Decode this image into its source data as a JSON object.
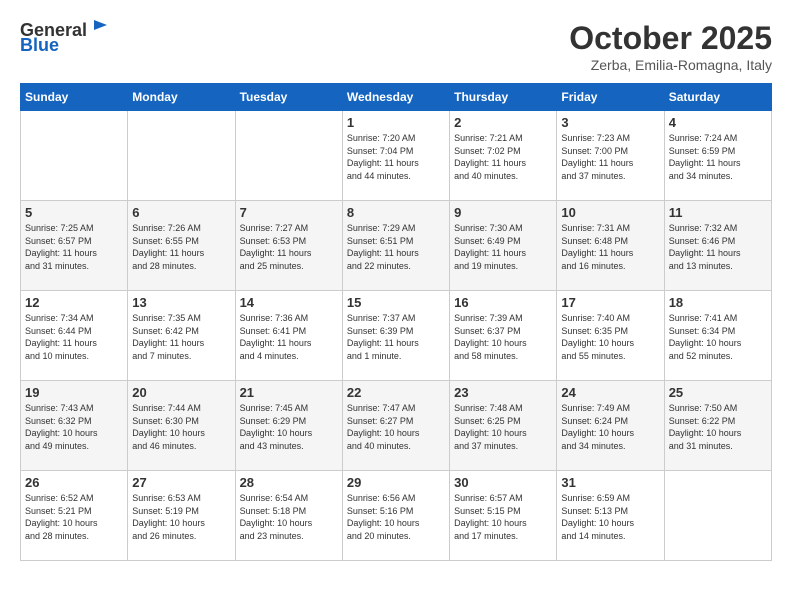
{
  "header": {
    "logo_general": "General",
    "logo_blue": "Blue",
    "month": "October 2025",
    "location": "Zerba, Emilia-Romagna, Italy"
  },
  "weekdays": [
    "Sunday",
    "Monday",
    "Tuesday",
    "Wednesday",
    "Thursday",
    "Friday",
    "Saturday"
  ],
  "weeks": [
    [
      {
        "day": "",
        "info": ""
      },
      {
        "day": "",
        "info": ""
      },
      {
        "day": "",
        "info": ""
      },
      {
        "day": "1",
        "info": "Sunrise: 7:20 AM\nSunset: 7:04 PM\nDaylight: 11 hours\nand 44 minutes."
      },
      {
        "day": "2",
        "info": "Sunrise: 7:21 AM\nSunset: 7:02 PM\nDaylight: 11 hours\nand 40 minutes."
      },
      {
        "day": "3",
        "info": "Sunrise: 7:23 AM\nSunset: 7:00 PM\nDaylight: 11 hours\nand 37 minutes."
      },
      {
        "day": "4",
        "info": "Sunrise: 7:24 AM\nSunset: 6:59 PM\nDaylight: 11 hours\nand 34 minutes."
      }
    ],
    [
      {
        "day": "5",
        "info": "Sunrise: 7:25 AM\nSunset: 6:57 PM\nDaylight: 11 hours\nand 31 minutes."
      },
      {
        "day": "6",
        "info": "Sunrise: 7:26 AM\nSunset: 6:55 PM\nDaylight: 11 hours\nand 28 minutes."
      },
      {
        "day": "7",
        "info": "Sunrise: 7:27 AM\nSunset: 6:53 PM\nDaylight: 11 hours\nand 25 minutes."
      },
      {
        "day": "8",
        "info": "Sunrise: 7:29 AM\nSunset: 6:51 PM\nDaylight: 11 hours\nand 22 minutes."
      },
      {
        "day": "9",
        "info": "Sunrise: 7:30 AM\nSunset: 6:49 PM\nDaylight: 11 hours\nand 19 minutes."
      },
      {
        "day": "10",
        "info": "Sunrise: 7:31 AM\nSunset: 6:48 PM\nDaylight: 11 hours\nand 16 minutes."
      },
      {
        "day": "11",
        "info": "Sunrise: 7:32 AM\nSunset: 6:46 PM\nDaylight: 11 hours\nand 13 minutes."
      }
    ],
    [
      {
        "day": "12",
        "info": "Sunrise: 7:34 AM\nSunset: 6:44 PM\nDaylight: 11 hours\nand 10 minutes."
      },
      {
        "day": "13",
        "info": "Sunrise: 7:35 AM\nSunset: 6:42 PM\nDaylight: 11 hours\nand 7 minutes."
      },
      {
        "day": "14",
        "info": "Sunrise: 7:36 AM\nSunset: 6:41 PM\nDaylight: 11 hours\nand 4 minutes."
      },
      {
        "day": "15",
        "info": "Sunrise: 7:37 AM\nSunset: 6:39 PM\nDaylight: 11 hours\nand 1 minute."
      },
      {
        "day": "16",
        "info": "Sunrise: 7:39 AM\nSunset: 6:37 PM\nDaylight: 10 hours\nand 58 minutes."
      },
      {
        "day": "17",
        "info": "Sunrise: 7:40 AM\nSunset: 6:35 PM\nDaylight: 10 hours\nand 55 minutes."
      },
      {
        "day": "18",
        "info": "Sunrise: 7:41 AM\nSunset: 6:34 PM\nDaylight: 10 hours\nand 52 minutes."
      }
    ],
    [
      {
        "day": "19",
        "info": "Sunrise: 7:43 AM\nSunset: 6:32 PM\nDaylight: 10 hours\nand 49 minutes."
      },
      {
        "day": "20",
        "info": "Sunrise: 7:44 AM\nSunset: 6:30 PM\nDaylight: 10 hours\nand 46 minutes."
      },
      {
        "day": "21",
        "info": "Sunrise: 7:45 AM\nSunset: 6:29 PM\nDaylight: 10 hours\nand 43 minutes."
      },
      {
        "day": "22",
        "info": "Sunrise: 7:47 AM\nSunset: 6:27 PM\nDaylight: 10 hours\nand 40 minutes."
      },
      {
        "day": "23",
        "info": "Sunrise: 7:48 AM\nSunset: 6:25 PM\nDaylight: 10 hours\nand 37 minutes."
      },
      {
        "day": "24",
        "info": "Sunrise: 7:49 AM\nSunset: 6:24 PM\nDaylight: 10 hours\nand 34 minutes."
      },
      {
        "day": "25",
        "info": "Sunrise: 7:50 AM\nSunset: 6:22 PM\nDaylight: 10 hours\nand 31 minutes."
      }
    ],
    [
      {
        "day": "26",
        "info": "Sunrise: 6:52 AM\nSunset: 5:21 PM\nDaylight: 10 hours\nand 28 minutes."
      },
      {
        "day": "27",
        "info": "Sunrise: 6:53 AM\nSunset: 5:19 PM\nDaylight: 10 hours\nand 26 minutes."
      },
      {
        "day": "28",
        "info": "Sunrise: 6:54 AM\nSunset: 5:18 PM\nDaylight: 10 hours\nand 23 minutes."
      },
      {
        "day": "29",
        "info": "Sunrise: 6:56 AM\nSunset: 5:16 PM\nDaylight: 10 hours\nand 20 minutes."
      },
      {
        "day": "30",
        "info": "Sunrise: 6:57 AM\nSunset: 5:15 PM\nDaylight: 10 hours\nand 17 minutes."
      },
      {
        "day": "31",
        "info": "Sunrise: 6:59 AM\nSunset: 5:13 PM\nDaylight: 10 hours\nand 14 minutes."
      },
      {
        "day": "",
        "info": ""
      }
    ]
  ]
}
